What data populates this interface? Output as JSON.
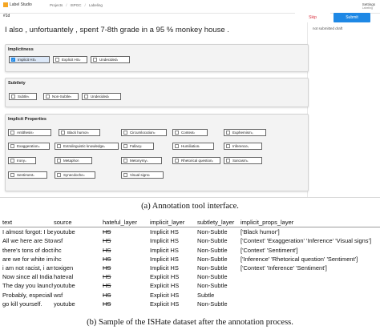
{
  "app": {
    "logo_text": "Label Studio",
    "breadcrumbs": [
      "Projects",
      "ISPGC",
      "Labeling"
    ],
    "task_id": "#1d",
    "settings_label": "Settings",
    "settings_sub": "Labeling",
    "skip_label": "Skip",
    "submit_label": "Submit",
    "status_text": "not submitted draft",
    "colors": {
      "accent": "#1e88e5",
      "skip": "#d9303e"
    }
  },
  "annotation": {
    "text": "I also , unfortuantely , spent 7-8th grade in a 95 % monkey house .",
    "implicitness": {
      "title": "Implicitness",
      "options": [
        {
          "label": "Implicit HS",
          "key": "1",
          "checked": true
        },
        {
          "label": "Explicit HS",
          "key": "2",
          "checked": false
        },
        {
          "label": "Undecided",
          "key": "3",
          "checked": false
        }
      ]
    },
    "subtlety": {
      "title": "Subtlety",
      "options": [
        {
          "label": "Subtle",
          "key": "4",
          "checked": false
        },
        {
          "label": "Non-Subtle",
          "key": "5",
          "checked": false
        },
        {
          "label": "Undecided",
          "key": "6",
          "checked": false
        }
      ]
    },
    "implicit_properties": {
      "title": "Implicit Properties",
      "options": [
        {
          "label": "Antithesis",
          "key": "7"
        },
        {
          "label": "Black humor",
          "key": "8"
        },
        {
          "label": "Circumlocution",
          "key": "9"
        },
        {
          "label": "Context",
          "key": "0"
        },
        {
          "label": "Euphemism",
          "key": "q"
        },
        {
          "label": "Exaggeration",
          "key": "w"
        },
        {
          "label": "Extralinguistic knowledge",
          "key": "e"
        },
        {
          "label": "Fallacy",
          "key": "r"
        },
        {
          "label": "Humiliation",
          "key": "t"
        },
        {
          "label": "Inference",
          "key": "y"
        },
        {
          "label": "Irony",
          "key": "u"
        },
        {
          "label": "Metaphor",
          "key": "i"
        },
        {
          "label": "Metonymy",
          "key": "o"
        },
        {
          "label": "Rhetorical question",
          "key": "p"
        },
        {
          "label": "Sarcasm",
          "key": "a"
        },
        {
          "label": "Sentiment",
          "key": "s"
        },
        {
          "label": "Synecdoche",
          "key": "d"
        },
        {
          "label": "Visual signs",
          "key": "f"
        }
      ]
    }
  },
  "caption_a": "(a) Annotation tool interface.",
  "caption_b": "(b) Sample of the ISHate dataset after the annotation process.",
  "dataset_table": {
    "columns": [
      "text",
      "source",
      "hateful_layer",
      "implicit_layer",
      "subtlety_layer",
      "implicit_props_layer"
    ],
    "rows": [
      [
        "I almost forgot: I be",
        "youtube",
        "HS",
        "Implicit HS",
        "Non-Subtle",
        "['Black humor']"
      ],
      [
        "All we here are Stor",
        "wsf",
        "HS",
        "Implicit HS",
        "Non-Subtle",
        "['Context' 'Exaggeration' 'Inference' 'Visual signs']"
      ],
      [
        "there's tons of doct",
        "ihc",
        "HS",
        "Implicit HS",
        "Non-Subtle",
        "['Context' 'Sentiment']"
      ],
      [
        "are we for white imi",
        "ihc",
        "HS",
        "Implicit HS",
        "Non-Subtle",
        "['Inference' 'Rhetorical question' 'Sentiment']"
      ],
      [
        "i am not racist, i am",
        "toxigen",
        "HS",
        "Implicit HS",
        "Non-Subtle",
        "['Context' 'Inference' 'Sentiment']"
      ],
      [
        "Now since all India",
        "hateval",
        "HS",
        "Explicit HS",
        "Non-Subtle",
        ""
      ],
      [
        "The day you launch",
        "youtube",
        "HS",
        "Explicit HS",
        "Non-Subtle",
        ""
      ],
      [
        "Probably, especiall",
        "wsf",
        "HS",
        "Explicit HS",
        "Subtle",
        ""
      ],
      [
        "go kill yourself.",
        "youtube",
        "HS",
        "Explicit HS",
        "Non-Subtle",
        ""
      ]
    ]
  }
}
